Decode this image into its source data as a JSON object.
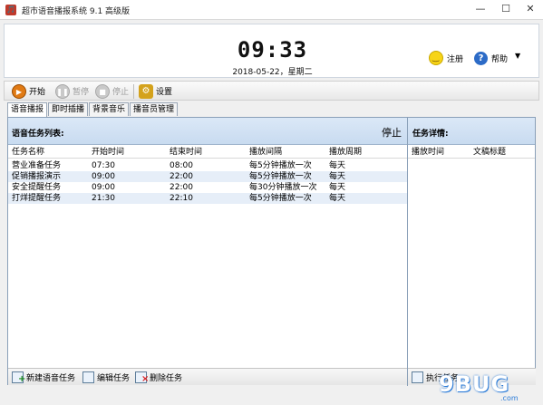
{
  "window": {
    "title": "超市语音播报系统 9.1 高级版",
    "min": "—",
    "max": "☐",
    "close": "✕",
    "app_icon": "🎵"
  },
  "header": {
    "clock": "09:33",
    "date": "2018-05-22，星期二",
    "register_label": "注册",
    "help_label": "帮助",
    "caret": "▼",
    "help_glyph": "?"
  },
  "toolbar": {
    "start_label": "开始",
    "pause_label": "暂停",
    "stop_label": "停止",
    "settings_label": "设置",
    "play_glyph": "▶",
    "pause_glyph": "❚❚",
    "stop_glyph": "■",
    "settings_glyph": "⚙"
  },
  "tabs": [
    {
      "label": "语音播报"
    },
    {
      "label": "即时插播"
    },
    {
      "label": "背景音乐"
    },
    {
      "label": "播音员管理"
    }
  ],
  "left_panel": {
    "title": "语音任务列表:",
    "status": "停止",
    "columns": [
      "任务名称",
      "开始时间",
      "结束时间",
      "播放间隔",
      "播放周期"
    ],
    "rows": [
      [
        "营业准备任务",
        "07:30",
        "08:00",
        "每5分钟播放一次",
        "每天"
      ],
      [
        "促销播报演示",
        "09:00",
        "22:00",
        "每5分钟播放一次",
        "每天"
      ],
      [
        "安全提醒任务",
        "09:00",
        "22:00",
        "每30分钟播放一次",
        "每天"
      ],
      [
        "打烊提醒任务",
        "21:30",
        "22:10",
        "每5分钟播放一次",
        "每天"
      ]
    ],
    "new_task_label": "新建语音任务",
    "edit_task_label": "编辑任务",
    "delete_task_label": "删除任务"
  },
  "right_panel": {
    "title": "任务详情:",
    "columns": [
      "播放时间",
      "文稿标题"
    ],
    "bottom_label": "执行任务"
  },
  "watermark": {
    "text": "9BUG",
    "sub": ".com"
  },
  "colors": {
    "header_gradient": "#c8dbf0",
    "accent_play": "#e07a14"
  }
}
